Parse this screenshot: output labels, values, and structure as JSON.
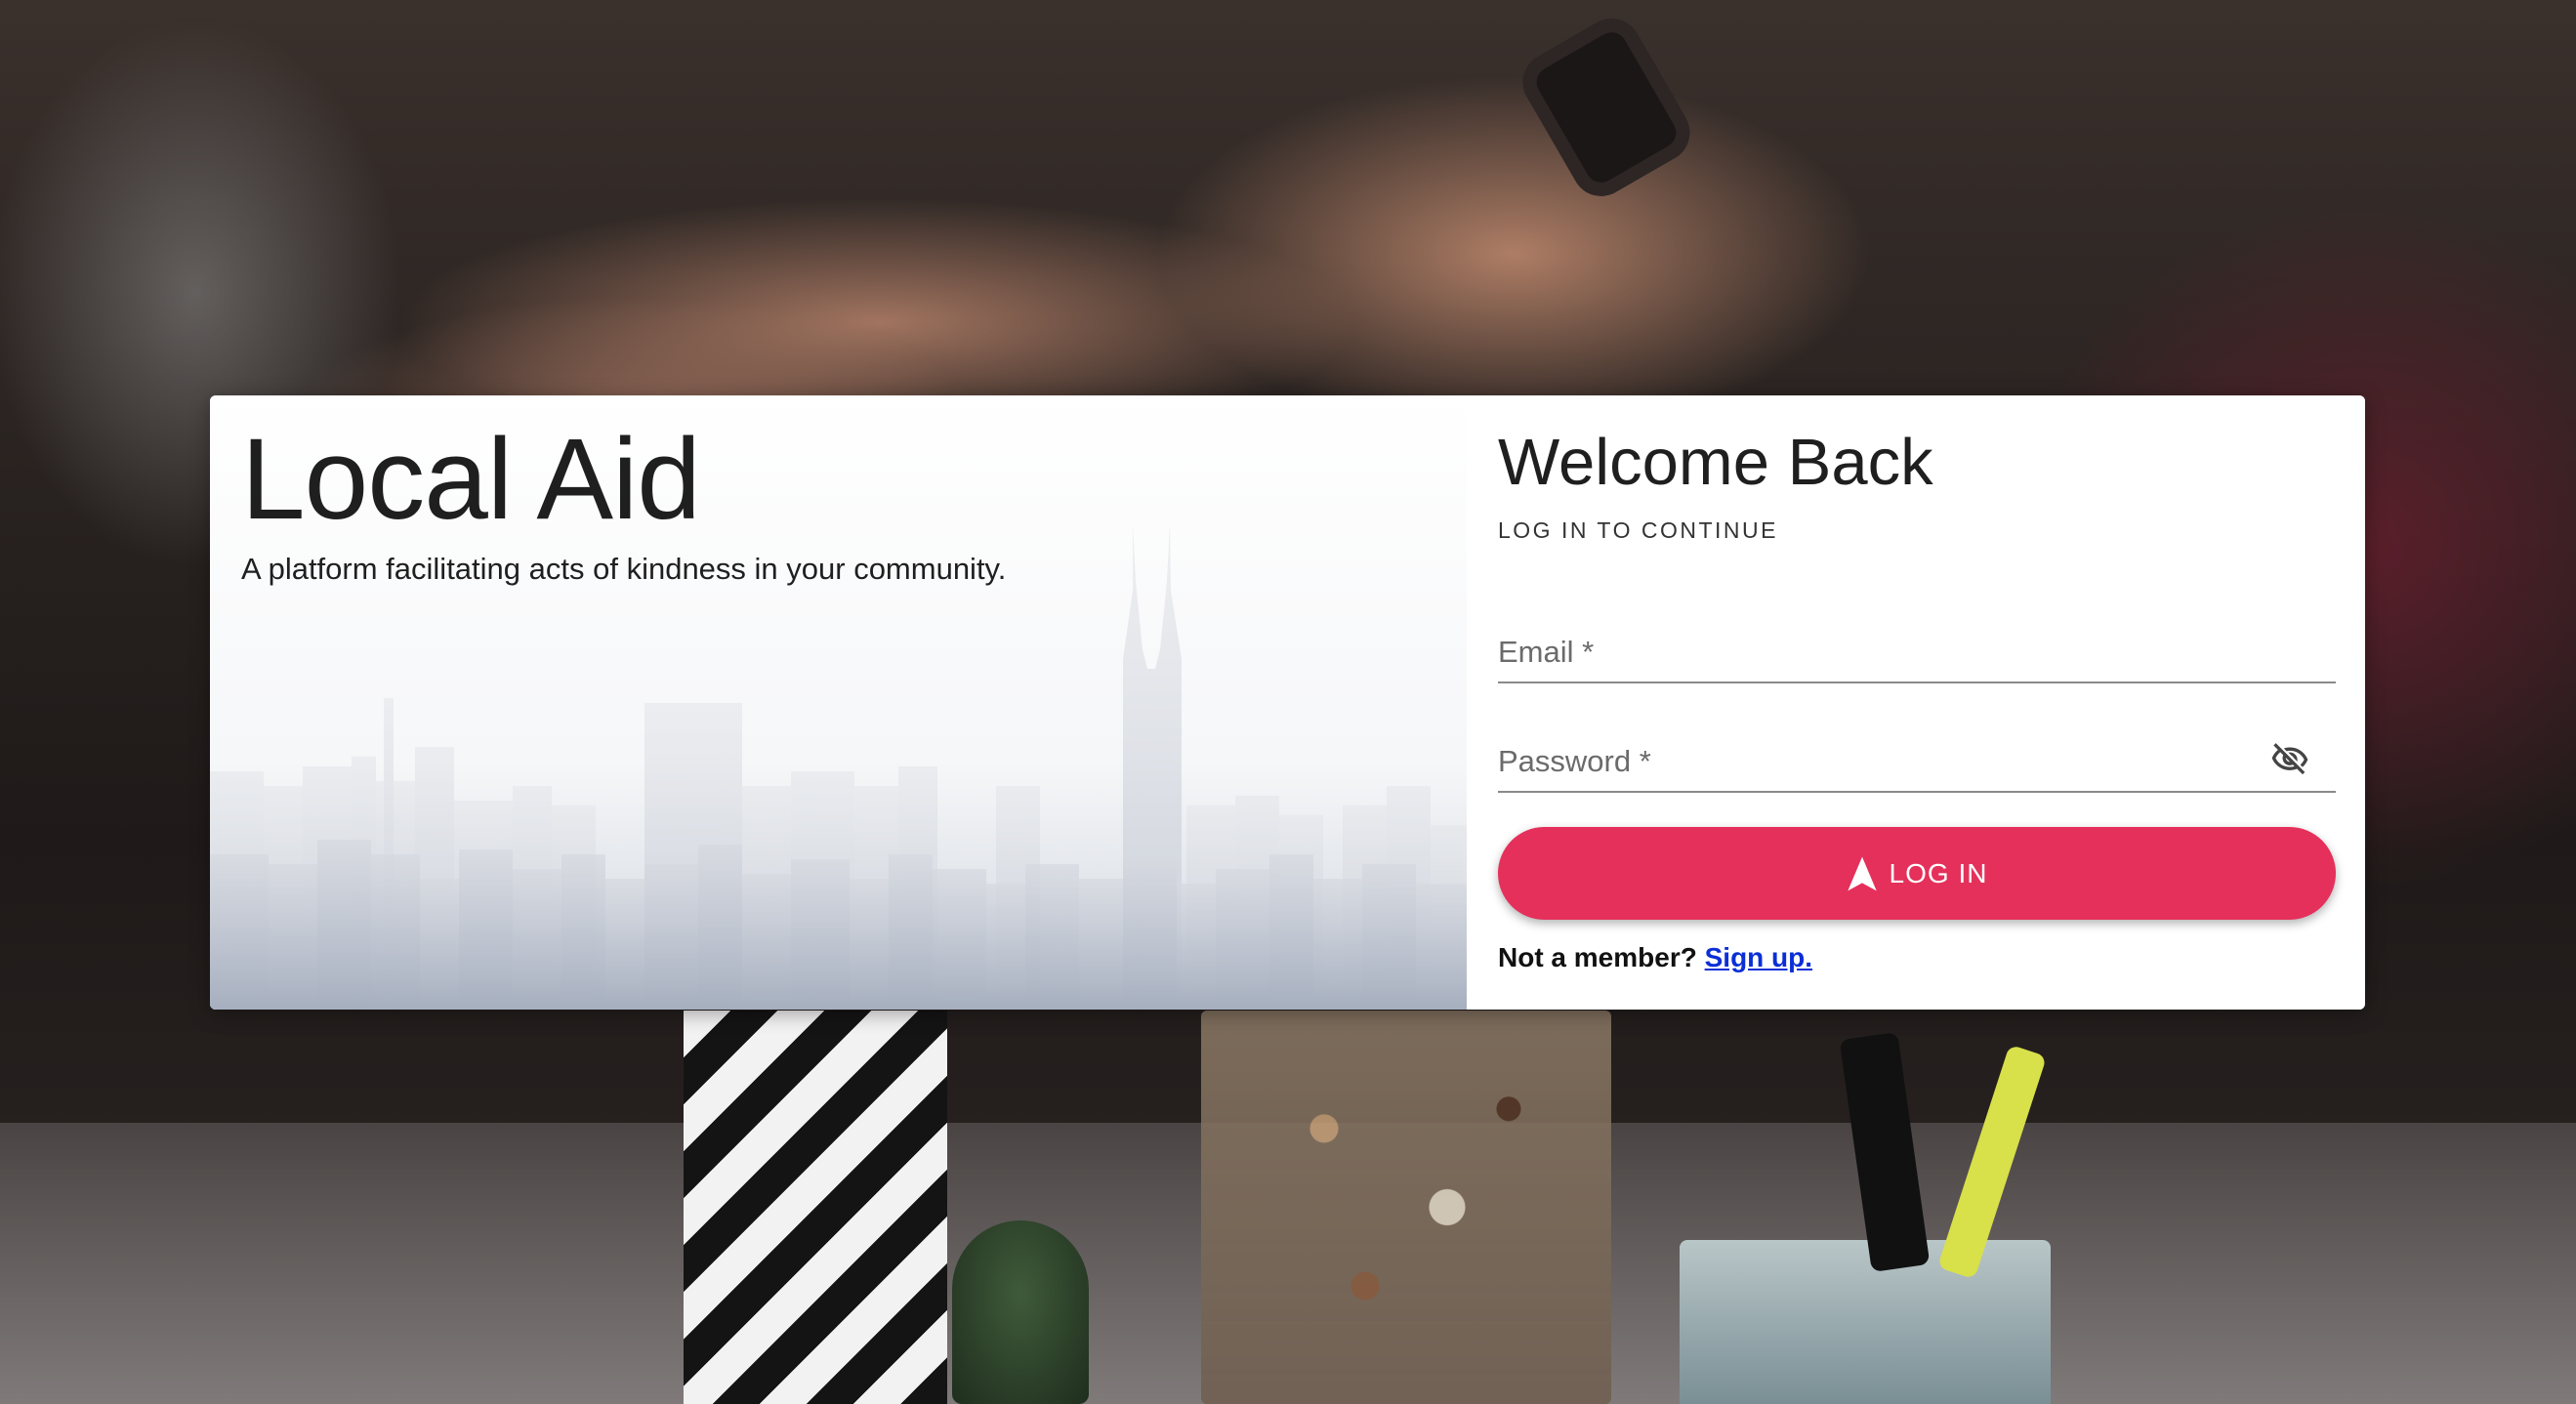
{
  "brand": {
    "title": "Local Aid",
    "tagline": "A platform facilitating acts of kindness in your community."
  },
  "login": {
    "heading": "Welcome Back",
    "subheading": "LOG IN TO CONTINUE",
    "email_label": "Email *",
    "password_label": "Password *",
    "email_value": "",
    "password_value": "",
    "submit_label": "LOG IN",
    "signup_prompt": "Not a member?",
    "signup_link": "Sign up."
  },
  "icons": {
    "password_toggle": "eye-off-icon",
    "submit": "navigation-arrow-icon"
  },
  "colors": {
    "accent": "#e5305b",
    "link": "#0a2fd6"
  }
}
